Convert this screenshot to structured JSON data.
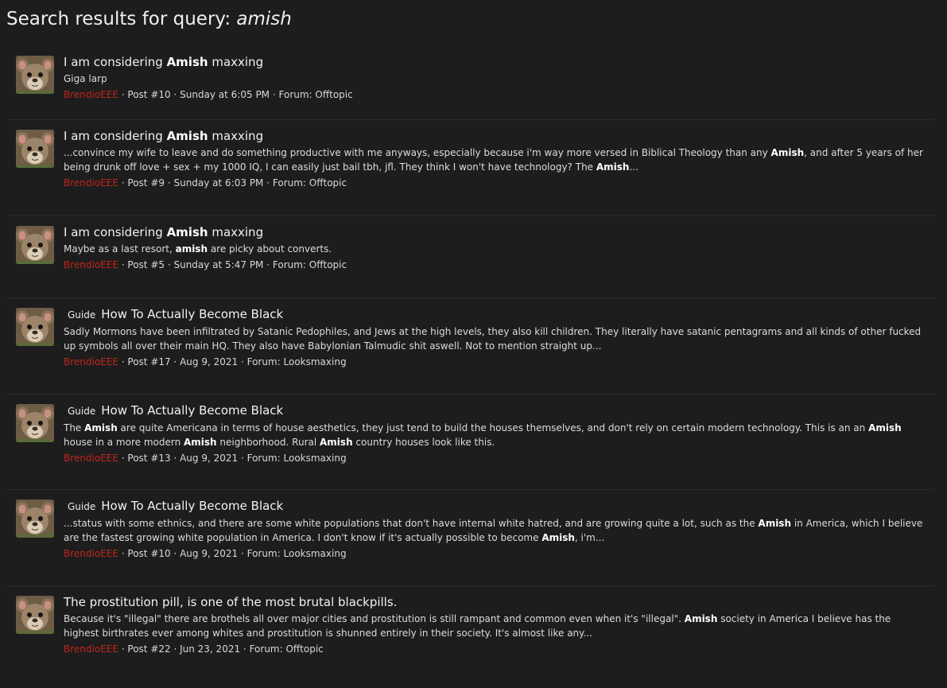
{
  "header": {
    "title_prefix": "Search results for query:",
    "query": "amish"
  },
  "results": [
    {
      "prefix": "",
      "title": [
        {
          "t": "I am considering "
        },
        {
          "t": "Amish",
          "b": true
        },
        {
          "t": " maxxing"
        }
      ],
      "snippet": [
        {
          "t": "Giga larp"
        }
      ],
      "author": "BrendioEEE",
      "post": "Post #10",
      "date": "Sunday at 6:05 PM",
      "forum": "Forum: Offtopic"
    },
    {
      "prefix": "",
      "title": [
        {
          "t": "I am considering "
        },
        {
          "t": "Amish",
          "b": true
        },
        {
          "t": " maxxing"
        }
      ],
      "snippet": [
        {
          "t": "...convince my wife to leave and do something productive with me anyways, especially because i'm way more versed in Biblical Theology than any "
        },
        {
          "t": "Amish",
          "b": true
        },
        {
          "t": ", and after 5 years of her being drunk off love + sex + my 1000 IQ, I can easily just bail tbh, jfl. They think I won't have technology? The "
        },
        {
          "t": "Amish",
          "b": true
        },
        {
          "t": "..."
        }
      ],
      "author": "BrendioEEE",
      "post": "Post #9",
      "date": "Sunday at 6:03 PM",
      "forum": "Forum: Offtopic"
    },
    {
      "prefix": "",
      "title": [
        {
          "t": "I am considering "
        },
        {
          "t": "Amish",
          "b": true
        },
        {
          "t": " maxxing"
        }
      ],
      "snippet": [
        {
          "t": "Maybe as a last resort, "
        },
        {
          "t": "amish",
          "b": true
        },
        {
          "t": " are picky about converts."
        }
      ],
      "author": "BrendioEEE",
      "post": "Post #5",
      "date": "Sunday at 5:47 PM",
      "forum": "Forum: Offtopic"
    },
    {
      "prefix": "Guide",
      "title": [
        {
          "t": "How To Actually Become Black"
        }
      ],
      "snippet": [
        {
          "t": "Sadly Mormons have been infiltrated by Satanic Pedophiles, and Jews at the high levels, they also kill children. They literally have satanic pentagrams and all kinds of other fucked up symbols all over their main HQ. They also have Babylonian Talmudic shit aswell. Not to mention straight up..."
        }
      ],
      "author": "BrendioEEE",
      "post": "Post #17",
      "date": "Aug 9, 2021",
      "forum": "Forum: Looksmaxing"
    },
    {
      "prefix": "Guide",
      "title": [
        {
          "t": "How To Actually Become Black"
        }
      ],
      "snippet": [
        {
          "t": "The "
        },
        {
          "t": "Amish",
          "b": true
        },
        {
          "t": " are quite Americana in terms of house aesthetics, they just tend to build the houses themselves, and don't rely on certain modern technology. This is an an "
        },
        {
          "t": "Amish",
          "b": true
        },
        {
          "t": " house in a more modern "
        },
        {
          "t": "Amish",
          "b": true
        },
        {
          "t": " neighborhood. Rural "
        },
        {
          "t": "Amish",
          "b": true
        },
        {
          "t": " country houses look like this."
        }
      ],
      "author": "BrendioEEE",
      "post": "Post #13",
      "date": "Aug 9, 2021",
      "forum": "Forum: Looksmaxing"
    },
    {
      "prefix": "Guide",
      "title": [
        {
          "t": "How To Actually Become Black"
        }
      ],
      "snippet": [
        {
          "t": "...status with some ethnics, and there are some white populations that don't have internal white hatred, and are growing quite a lot, such as the "
        },
        {
          "t": "Amish",
          "b": true
        },
        {
          "t": " in America, which I believe are the fastest growing white population in America. I don't know if it's actually possible to become "
        },
        {
          "t": "Amish",
          "b": true
        },
        {
          "t": ", i'm..."
        }
      ],
      "author": "BrendioEEE",
      "post": "Post #10",
      "date": "Aug 9, 2021",
      "forum": "Forum: Looksmaxing"
    },
    {
      "prefix": "",
      "title": [
        {
          "t": "The prostitution pill, is one of the most brutal blackpills."
        }
      ],
      "snippet": [
        {
          "t": "Because it's \"illegal\" there are brothels all over major cities and prostitution is still rampant and common even when it's \"illegal\". "
        },
        {
          "t": "Amish",
          "b": true
        },
        {
          "t": " society in America I believe has the highest birthrates ever among whites and prostitution is shunned entirely in their society. It's almost like any..."
        }
      ],
      "author": "BrendioEEE",
      "post": "Post #22",
      "date": "Jun 23, 2021",
      "forum": "Forum: Offtopic"
    }
  ],
  "meta_separator": " · ",
  "colors": {
    "background": "#1d1d1d",
    "author": "#c0251d"
  },
  "icons": {
    "avatar": "rat-avatar-icon"
  }
}
